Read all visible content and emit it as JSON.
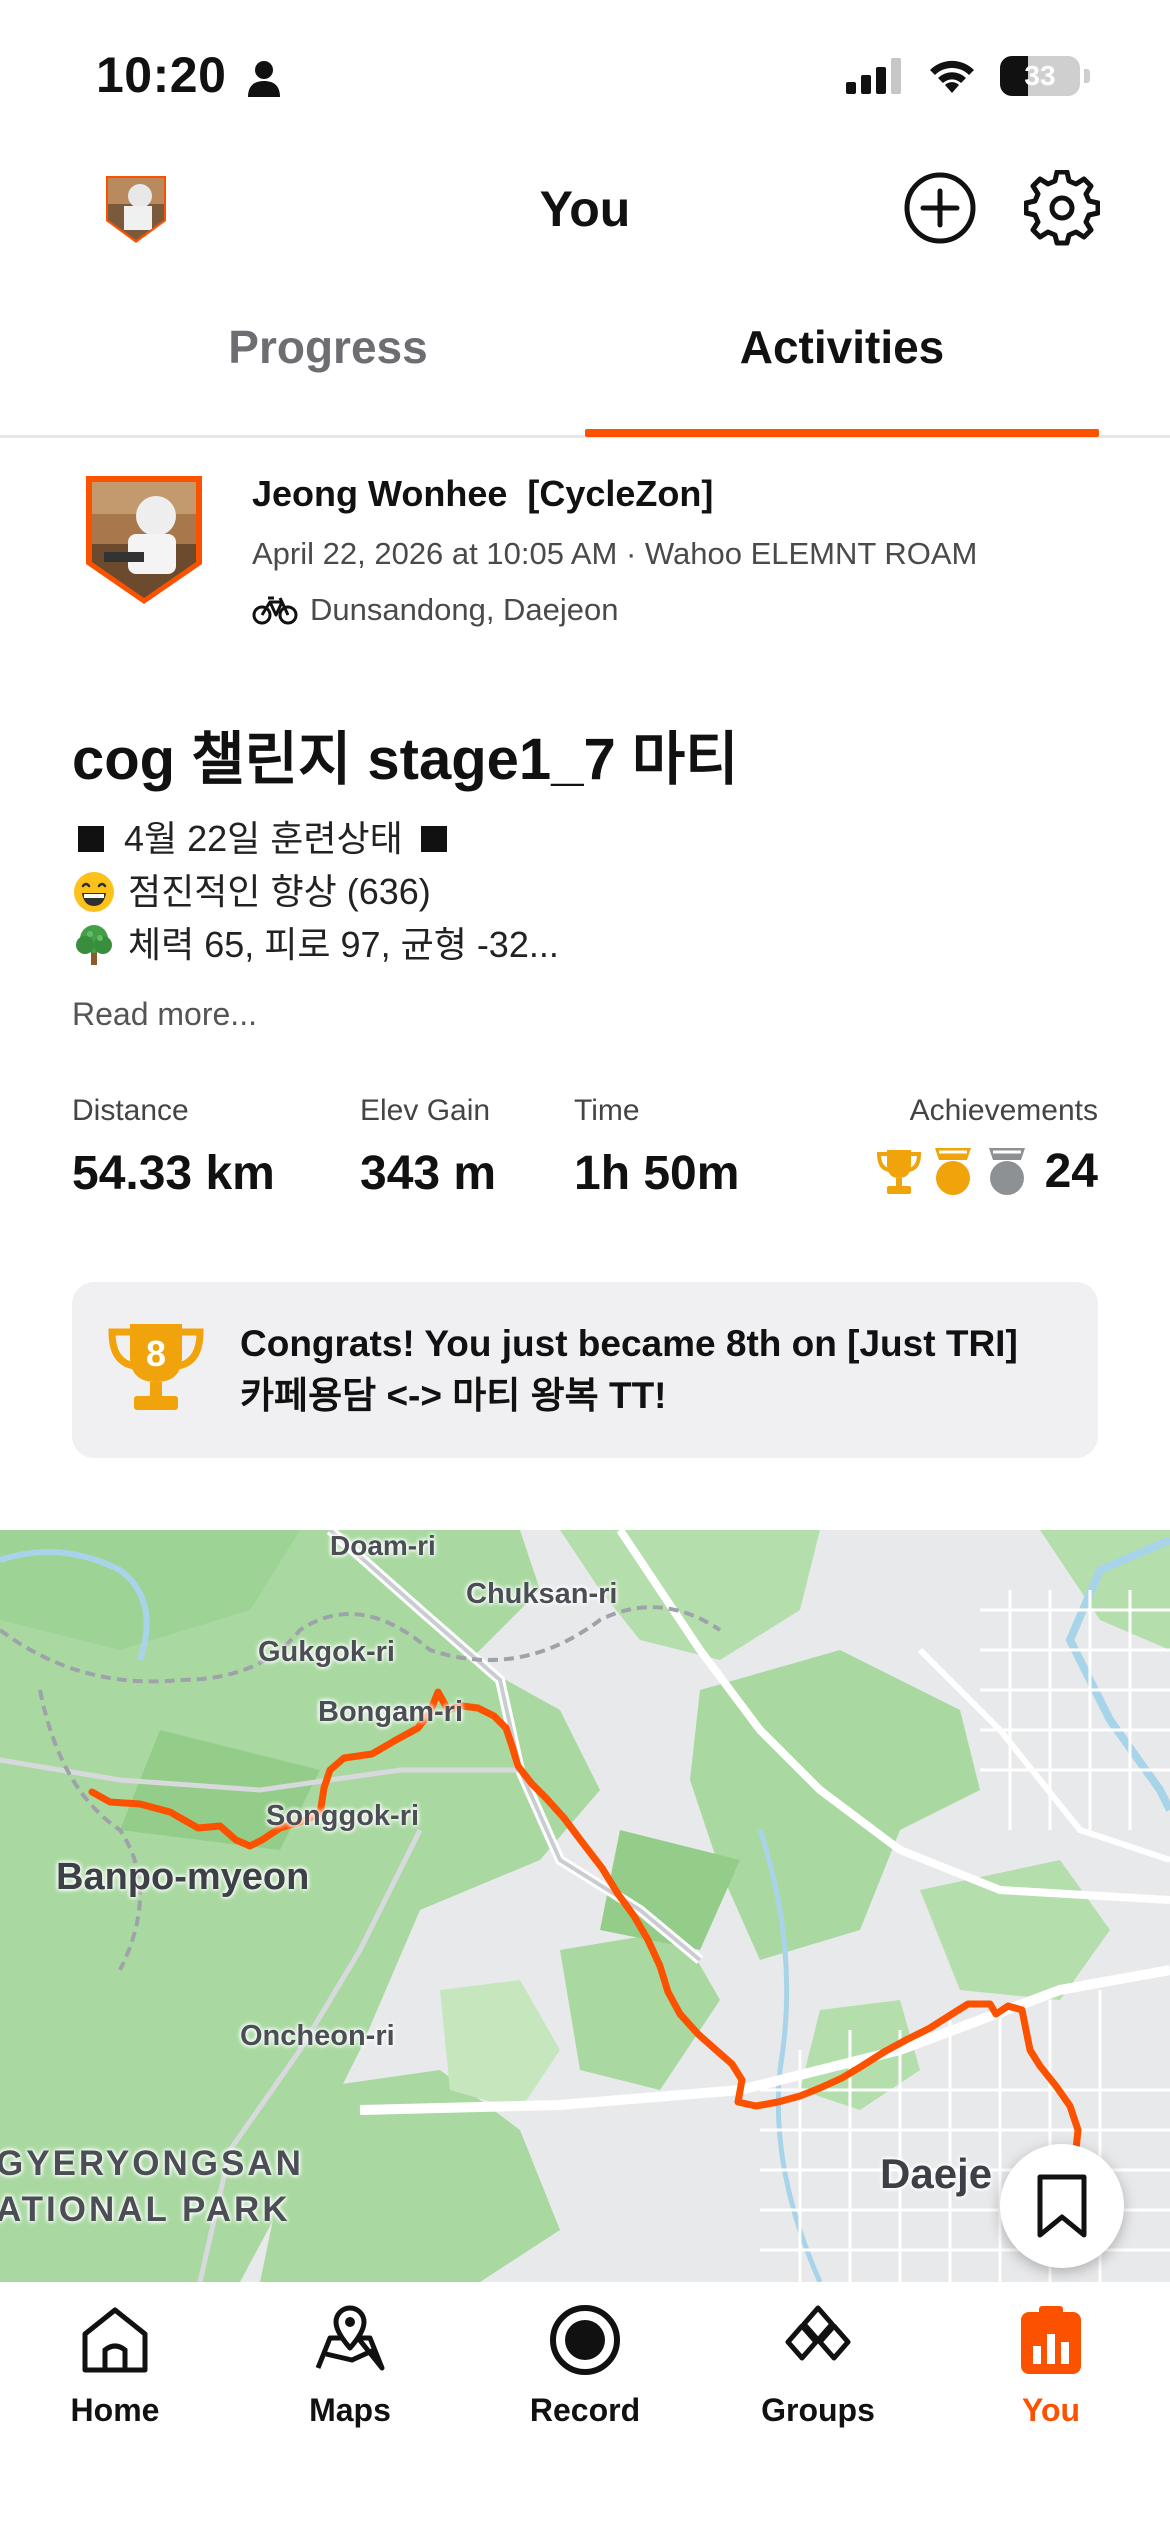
{
  "status_bar": {
    "time": "10:20",
    "battery_level": "33",
    "icons": [
      "person-icon",
      "signal-icon",
      "wifi-icon",
      "battery-icon"
    ]
  },
  "header": {
    "title": "You",
    "icons": [
      "profile-avatar",
      "add-circle-icon",
      "gear-icon"
    ]
  },
  "tabs": [
    {
      "label": "Progress",
      "active": false
    },
    {
      "label": "Activities",
      "active": true
    }
  ],
  "activity": {
    "athlete": "Jeong Wonhee  [CycleZon]",
    "meta": "April 22, 2026 at 10:05 AM · Wahoo ELEMNT ROAM",
    "location": "Dunsandong, Daejeon",
    "title": "cog 챌린지 stage1_7 마티",
    "description": {
      "line1": "4월 22일 훈련상태",
      "line2": "점진적인 향상 (636)",
      "line3": "체력 65, 피로 97, 균형 -32..."
    },
    "read_more": "Read more...",
    "stats": {
      "distance_label": "Distance",
      "distance": "54.33 km",
      "elev_label": "Elev Gain",
      "elev": "343 m",
      "time_label": "Time",
      "time": "1h 50m",
      "achievements_label": "Achievements",
      "achievements": "24"
    },
    "congrats": {
      "rank": "8",
      "text": "Congrats! You just became 8th on [Just TRI] 카페용담 <-> 마티 왕복 TT!"
    }
  },
  "map": {
    "labels": {
      "doam": "Doam-ri",
      "chuksan": "Chuksan-ri",
      "gukgok": "Gukgok-ri",
      "bongam": "Bongam-ri",
      "songgok": "Songgok-ri",
      "banpo": "Banpo-myeon",
      "oncheon": "Oncheon-ri",
      "gyeryong1": "GYERYONGSAN",
      "gyeryong2": "ATIONAL PARK",
      "daejeon": "Daeje"
    },
    "route_color": "#fc5200",
    "forest_color": "#a9d9a1"
  },
  "bottom_nav": [
    {
      "label": "Home",
      "icon": "home-icon",
      "active": false
    },
    {
      "label": "Maps",
      "icon": "maps-icon",
      "active": false
    },
    {
      "label": "Record",
      "icon": "record-icon",
      "active": false
    },
    {
      "label": "Groups",
      "icon": "groups-icon",
      "active": false
    },
    {
      "label": "You",
      "icon": "you-icon",
      "active": true
    }
  ],
  "colors": {
    "accent": "#fc5200",
    "gold": "#f0a30a",
    "silver": "#8e9194"
  }
}
